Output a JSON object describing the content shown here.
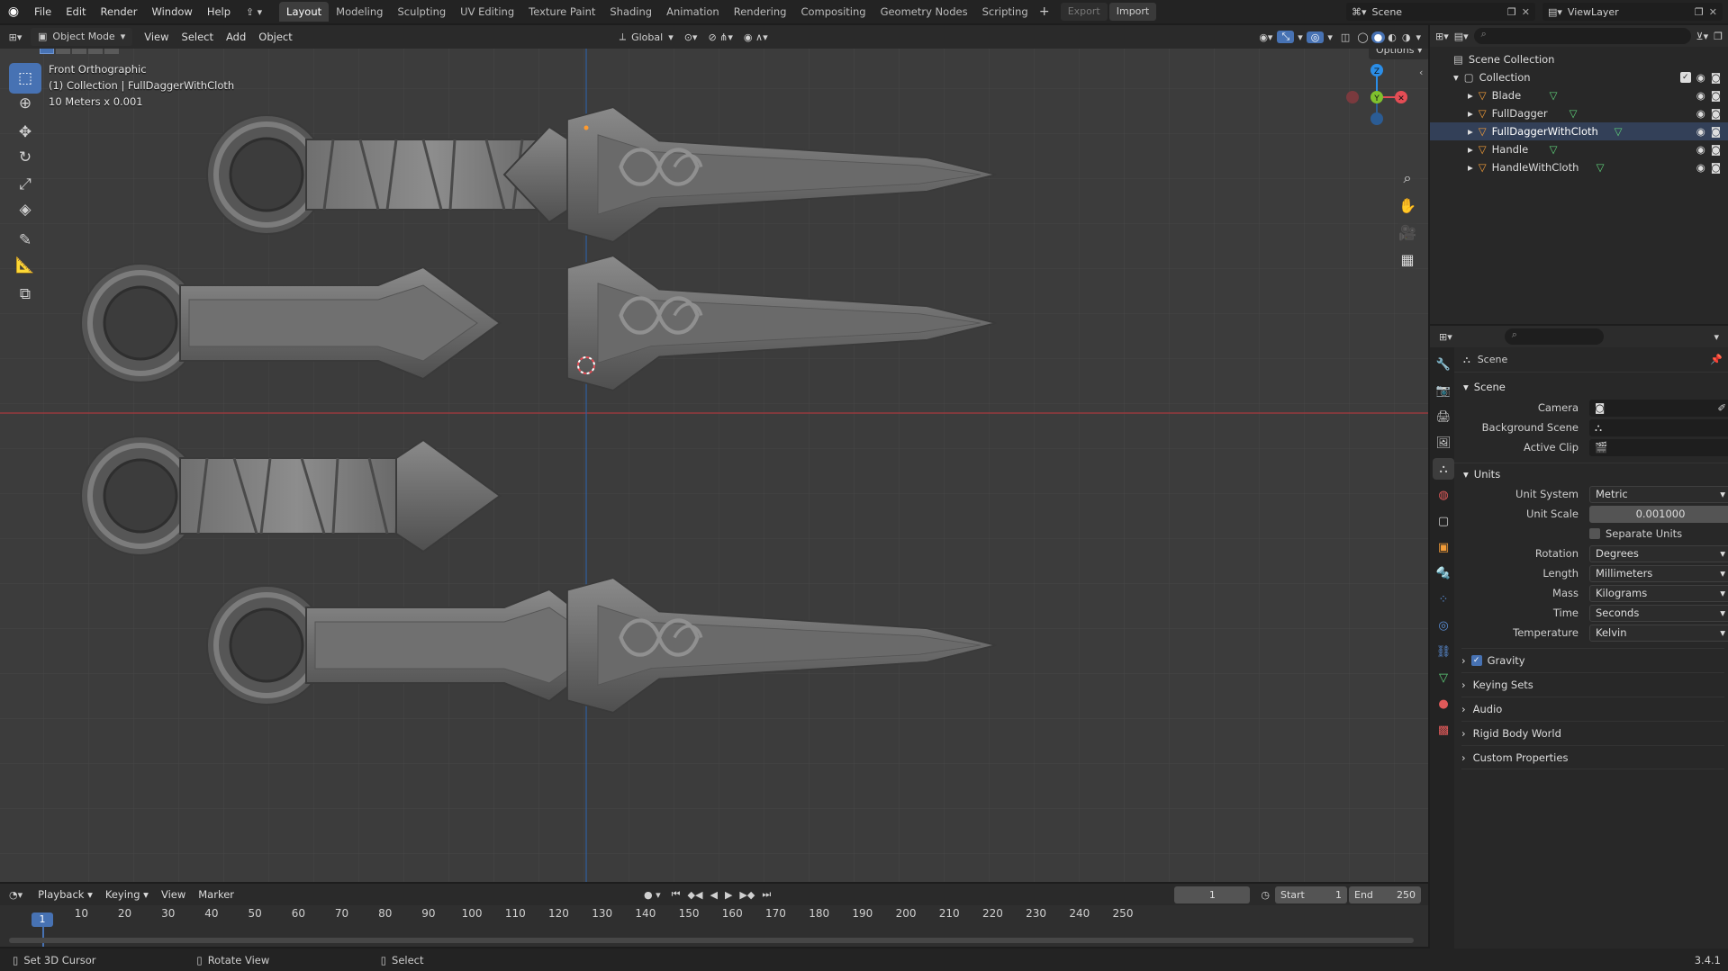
{
  "topbar": {
    "menus": [
      "File",
      "Edit",
      "Render",
      "Window",
      "Help"
    ],
    "workspaces": [
      "Layout",
      "Modeling",
      "Sculpting",
      "UV Editing",
      "Texture Paint",
      "Shading",
      "Animation",
      "Rendering",
      "Compositing",
      "Geometry Nodes",
      "Scripting"
    ],
    "active_workspace": "Layout",
    "export_label": "Export",
    "import_label": "Import",
    "scene_name": "Scene",
    "view_layer": "ViewLayer"
  },
  "viewport_header": {
    "mode": "Object Mode",
    "menus": [
      "View",
      "Select",
      "Add",
      "Object"
    ],
    "orientation": "Global",
    "options_label": "Options"
  },
  "viewport_overlay": {
    "view_name": "Front Orthographic",
    "collection_info": "(1) Collection | FullDaggerWithCloth",
    "scale_info": "10 Meters x 0.001",
    "gizmo_axes": {
      "z": "Z",
      "y": "Y"
    }
  },
  "outliner": {
    "scene_collection": "Scene Collection",
    "collection": "Collection",
    "objects": [
      "Blade",
      "FullDagger",
      "FullDaggerWithCloth",
      "Handle",
      "HandleWithCloth"
    ]
  },
  "properties": {
    "context": "Scene",
    "scene_section": "Scene",
    "camera_label": "Camera",
    "background_scene_label": "Background Scene",
    "active_clip_label": "Active Clip",
    "units_section": "Units",
    "unit_system_label": "Unit System",
    "unit_system": "Metric",
    "unit_scale_label": "Unit Scale",
    "unit_scale": "0.001000",
    "separate_units_label": "Separate Units",
    "rotation_label": "Rotation",
    "rotation": "Degrees",
    "length_label": "Length",
    "length": "Millimeters",
    "mass_label": "Mass",
    "mass": "Kilograms",
    "time_label": "Time",
    "time": "Seconds",
    "temperature_label": "Temperature",
    "temperature": "Kelvin",
    "gravity_label": "Gravity",
    "collapsed_sections": [
      "Keying Sets",
      "Audio",
      "Rigid Body World",
      "Custom Properties"
    ]
  },
  "timeline": {
    "menus": [
      "Playback",
      "Keying",
      "View",
      "Marker"
    ],
    "current_frame": "1",
    "start_label": "Start",
    "start": "1",
    "end_label": "End",
    "end": "250",
    "ruler_labels": [
      "10",
      "20",
      "30",
      "40",
      "50",
      "60",
      "70",
      "80",
      "90",
      "100",
      "110",
      "120",
      "130",
      "140",
      "150",
      "160",
      "170",
      "180",
      "190",
      "200",
      "210",
      "220",
      "230",
      "240",
      "250"
    ],
    "playhead_label": "1"
  },
  "statusbar": {
    "left_hint": "Set 3D Cursor",
    "middle_hint": "Rotate View",
    "right_hint": "Select",
    "version": "3.4.1"
  },
  "colors": {
    "accent": "#4772b3",
    "x_axis": "#e44d55",
    "y_axis": "#7fc12e",
    "z_axis": "#2b8ee8",
    "viewport_bg": "#3c3c3c"
  }
}
